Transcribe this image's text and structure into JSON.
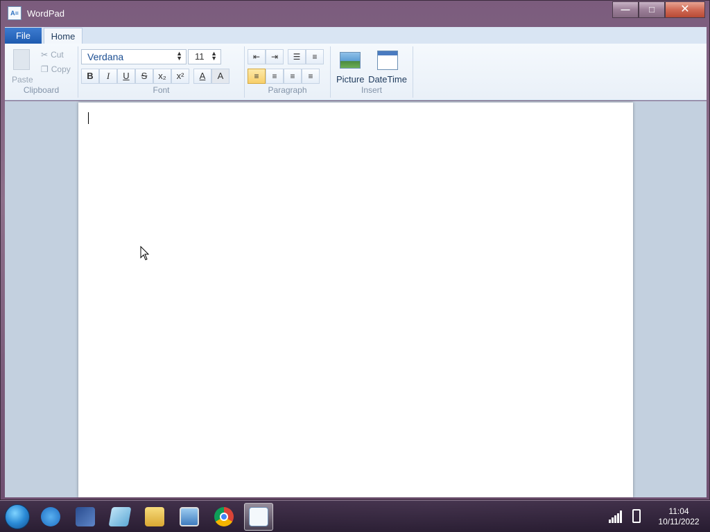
{
  "window": {
    "title": "WordPad",
    "app_icon": "wordpad-icon",
    "controls": {
      "minimize": "—",
      "maximize": "□",
      "close": "✕"
    }
  },
  "ribbon_tabs": [
    {
      "label": "File",
      "active": false
    },
    {
      "label": "Home",
      "active": true
    }
  ],
  "ribbon": {
    "clipboard": {
      "group_label": "Clipboard",
      "paste": "Paste",
      "cut": "Cut",
      "copy": "Copy"
    },
    "font": {
      "group_label": "Font",
      "family": "Verdana",
      "size": "11",
      "buttons": [
        {
          "label": "B",
          "name": "bold-button"
        },
        {
          "label": "I",
          "name": "italic-button"
        },
        {
          "label": "U",
          "name": "underline-button"
        },
        {
          "label": "S",
          "name": "strikethrough-button"
        },
        {
          "label": "x₂",
          "name": "subscript-button"
        },
        {
          "label": "x²",
          "name": "superscript-button"
        },
        {
          "label": "A",
          "name": "text-color-button"
        },
        {
          "label": "A",
          "name": "highlight-color-button"
        }
      ]
    },
    "paragraph": {
      "group_label": "Paragraph",
      "row1": [
        {
          "label": "⇤",
          "name": "decrease-indent-button"
        },
        {
          "label": "⇥",
          "name": "increase-indent-button"
        },
        {
          "label": "☰",
          "name": "bullets-button"
        },
        {
          "label": "≡",
          "name": "numbering-button"
        }
      ],
      "row2": [
        {
          "label": "≡",
          "name": "align-left-button",
          "active": true
        },
        {
          "label": "≡",
          "name": "align-center-button"
        },
        {
          "label": "≡",
          "name": "align-right-button"
        },
        {
          "label": "≡",
          "name": "justify-button"
        }
      ]
    },
    "insert": {
      "group_label": "Insert",
      "picture": "Picture",
      "datetime": "DateTime"
    }
  },
  "document": {
    "text": ""
  },
  "taskbar": {
    "items": [
      {
        "name": "start-button-icon",
        "active": false
      },
      {
        "name": "internet-explorer-icon",
        "active": false
      },
      {
        "name": "shortcut-app-icon",
        "active": false
      },
      {
        "name": "notepad-icon",
        "active": false
      },
      {
        "name": "file-explorer-icon",
        "active": false
      },
      {
        "name": "remote-desktop-icon",
        "active": false
      },
      {
        "name": "chrome-icon",
        "active": false
      },
      {
        "name": "wordpad-taskbar-icon",
        "active": true
      }
    ],
    "clock": {
      "time": "11:04",
      "date": "10/11/2022"
    }
  },
  "colors": {
    "accent": "#1e5bb0",
    "active_align": "#f8cf6a",
    "workspace_bg": "#c3d0df"
  }
}
